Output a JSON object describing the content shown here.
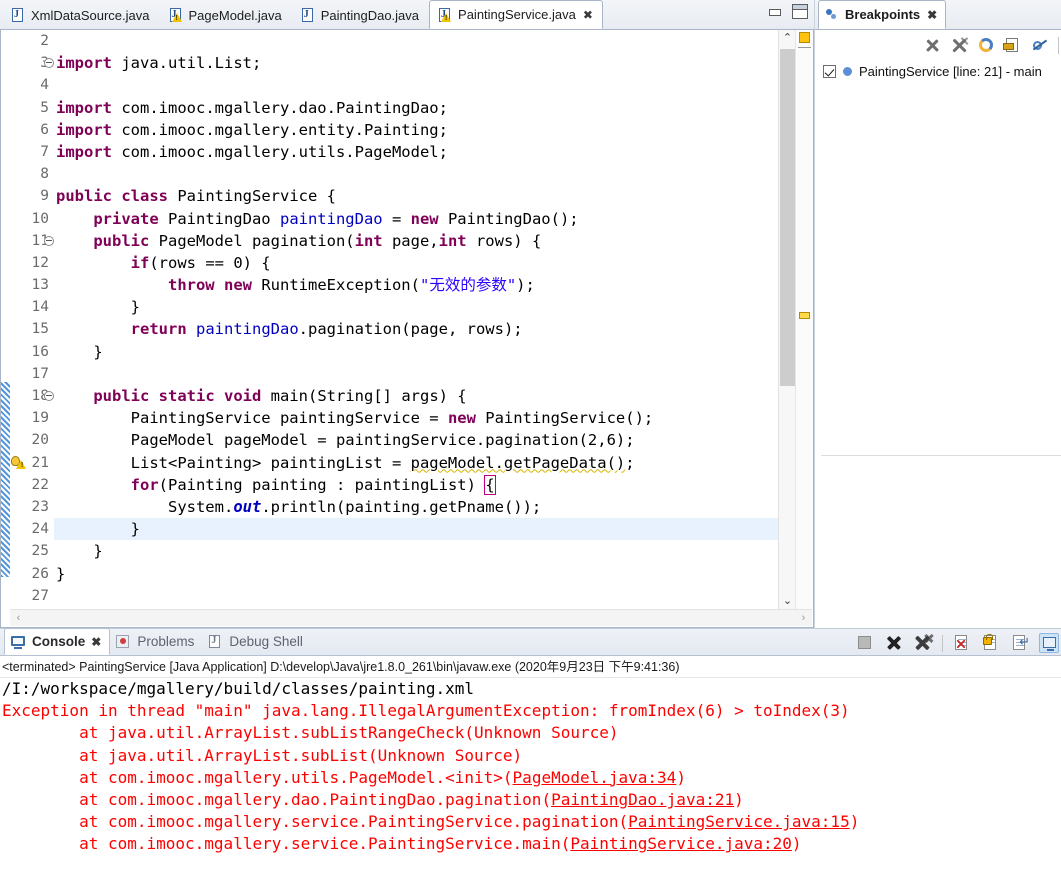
{
  "editor": {
    "tabs": [
      {
        "label": "XmlDataSource.java",
        "icon": "java-file-icon",
        "warning": false,
        "active": false,
        "closable": false
      },
      {
        "label": "PageModel.java",
        "icon": "java-file-warning-icon",
        "warning": true,
        "active": false,
        "closable": false
      },
      {
        "label": "PaintingDao.java",
        "icon": "java-file-icon",
        "warning": false,
        "active": false,
        "closable": false
      },
      {
        "label": "PaintingService.java",
        "icon": "java-file-warning-icon",
        "warning": true,
        "active": true,
        "closable": true
      }
    ],
    "close_glyph": "✖",
    "minimize_title": "Minimize",
    "maximize_title": "Maximize",
    "first_visible_line": 2,
    "last_partial_line": 27,
    "current_line": 24,
    "lines": [
      {
        "n": 2,
        "fold": false,
        "text": ""
      },
      {
        "n": 3,
        "fold": true,
        "text": "import java.util.List;"
      },
      {
        "n": 4,
        "fold": false,
        "text": ""
      },
      {
        "n": 5,
        "fold": false,
        "text": "import com.imooc.mgallery.dao.PaintingDao;"
      },
      {
        "n": 6,
        "fold": false,
        "text": "import com.imooc.mgallery.entity.Painting;"
      },
      {
        "n": 7,
        "fold": false,
        "text": "import com.imooc.mgallery.utils.PageModel;"
      },
      {
        "n": 8,
        "fold": false,
        "text": ""
      },
      {
        "n": 9,
        "fold": false,
        "text": "public class PaintingService {"
      },
      {
        "n": 10,
        "fold": false,
        "text": "    private PaintingDao paintingDao = new PaintingDao();"
      },
      {
        "n": 11,
        "fold": true,
        "text": "    public PageModel pagination(int page,int rows) {"
      },
      {
        "n": 12,
        "fold": false,
        "text": "        if(rows == 0) {"
      },
      {
        "n": 13,
        "fold": false,
        "text": "            throw new RuntimeException(\"无效的参数\");"
      },
      {
        "n": 14,
        "fold": false,
        "text": "        }"
      },
      {
        "n": 15,
        "fold": false,
        "text": "        return paintingDao.pagination(page, rows);"
      },
      {
        "n": 16,
        "fold": false,
        "text": "    }"
      },
      {
        "n": 17,
        "fold": false,
        "text": ""
      },
      {
        "n": 18,
        "fold": true,
        "text": "    public static void main(String[] args) {"
      },
      {
        "n": 19,
        "fold": false,
        "text": "        PaintingService paintingService = new PaintingService();"
      },
      {
        "n": 20,
        "fold": false,
        "text": "        PageModel pageModel = paintingService.pagination(2,6);"
      },
      {
        "n": 21,
        "fold": false,
        "warning": true,
        "text": "        List<Painting> paintingList = pageModel.getPageData();"
      },
      {
        "n": 22,
        "fold": false,
        "text": "        for(Painting painting : paintingList) {"
      },
      {
        "n": 23,
        "fold": false,
        "text": "            System.out.println(painting.getPname());"
      },
      {
        "n": 24,
        "fold": false,
        "text": "        }"
      },
      {
        "n": 25,
        "fold": false,
        "text": "    }"
      },
      {
        "n": 26,
        "fold": false,
        "text": "}"
      },
      {
        "n": 27,
        "fold": false,
        "text": ""
      }
    ],
    "colors": {
      "keyword": "#7F0055",
      "string": "#2A00FF",
      "field": "#0000C0",
      "current_line_highlight": "#E8F2FE",
      "marker_warning": "#FFC20E"
    }
  },
  "breakpoints": {
    "tab_label": "Breakpoints",
    "close_glyph": "✖",
    "toolbar": [
      {
        "name": "remove-breakpoint-button",
        "title": "Remove Selected Breakpoints"
      },
      {
        "name": "remove-all-breakpoints-button",
        "title": "Remove All Breakpoints"
      },
      {
        "name": "refresh-breakpoint-button",
        "title": "Link with Debug View"
      },
      {
        "name": "export-breakpoints-button",
        "title": "Export Breakpoints"
      },
      {
        "name": "skip-all-breakpoints-button",
        "title": "Skip All Breakpoints"
      }
    ],
    "items": [
      {
        "checked": true,
        "label": "PaintingService [line: 21] - main"
      }
    ]
  },
  "console": {
    "tabs": [
      {
        "label": "Console",
        "icon": "console-icon",
        "active": true,
        "closable": true
      },
      {
        "label": "Problems",
        "icon": "problems-icon",
        "active": false,
        "closable": false
      },
      {
        "label": "Debug Shell",
        "icon": "debugshell-icon",
        "active": false,
        "closable": false
      }
    ],
    "close_glyph": "✖",
    "toolbar": [
      {
        "name": "terminate-button",
        "title": "Terminate"
      },
      {
        "name": "remove-launch-button",
        "title": "Remove Launch"
      },
      {
        "name": "remove-all-terminated-button",
        "title": "Remove All Terminated Launches"
      },
      {
        "name": "clear-console-button",
        "title": "Clear Console"
      },
      {
        "name": "scroll-lock-button",
        "title": "Scroll Lock"
      },
      {
        "name": "word-wrap-button",
        "title": "Word Wrap"
      },
      {
        "name": "display-selected-console-button",
        "title": "Display Selected Console",
        "selected": true
      }
    ],
    "status_line": "<terminated> PaintingService [Java Application] D:\\develop\\Java\\jre1.8.0_261\\bin\\javaw.exe (2020年9月23日 下午9:41:36)",
    "output": [
      {
        "text": "/I:/workspace/mgallery/build/classes/painting.xml",
        "error": false
      },
      {
        "text": "Exception in thread \"main\" java.lang.IllegalArgumentException: fromIndex(6) > toIndex(3)",
        "error": true
      },
      {
        "text": "        at java.util.ArrayList.subListRangeCheck(Unknown Source)",
        "error": true
      },
      {
        "text": "        at java.util.ArrayList.subList(Unknown Source)",
        "error": true
      },
      {
        "prefix": "        at com.imooc.mgallery.utils.PageModel.<init>(",
        "link": "PageModel.java:34",
        "suffix": ")",
        "error": true
      },
      {
        "prefix": "        at com.imooc.mgallery.dao.PaintingDao.pagination(",
        "link": "PaintingDao.java:21",
        "suffix": ")",
        "error": true
      },
      {
        "prefix": "        at com.imooc.mgallery.service.PaintingService.pagination(",
        "link": "PaintingService.java:15",
        "suffix": ")",
        "error": true
      },
      {
        "prefix": "        at com.imooc.mgallery.service.PaintingService.main(",
        "link": "PaintingService.java:20",
        "suffix": ")",
        "error": true
      }
    ]
  },
  "scrollbars": {
    "editor_up_glyph": "⌃",
    "editor_down_glyph": "⌄",
    "editor_left_glyph": "‹",
    "editor_right_glyph": "›"
  }
}
